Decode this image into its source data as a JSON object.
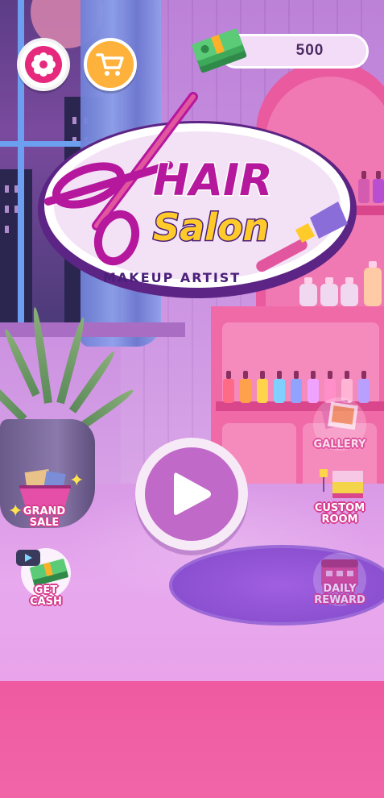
{
  "hud": {
    "cash_amount": "500",
    "settings_icon": "gear-icon",
    "shop_icon": "shopping-cart-icon",
    "cash_icon": "money-stack-icon"
  },
  "logo": {
    "line1": "HAIR",
    "line2": "Salon",
    "subtitle": "MAKEUP ARTIST"
  },
  "play": {
    "icon": "play-icon"
  },
  "side_buttons": {
    "grand_sale": {
      "line1": "GRAND",
      "line2": "SALE"
    },
    "get_cash": {
      "line1": "GET",
      "line2": "CASH"
    },
    "gallery": {
      "line1": "GALLERY"
    },
    "custom_room": {
      "line1": "CUSTOM",
      "line2": "ROOM"
    },
    "daily_reward": {
      "line1": "DAILY",
      "line2": "REWARD"
    }
  },
  "colors": {
    "accent_pink": "#e6297d",
    "shop_orange": "#ffb23b",
    "label_outline": "#d63b8e",
    "play_purple": "#c069c9"
  }
}
